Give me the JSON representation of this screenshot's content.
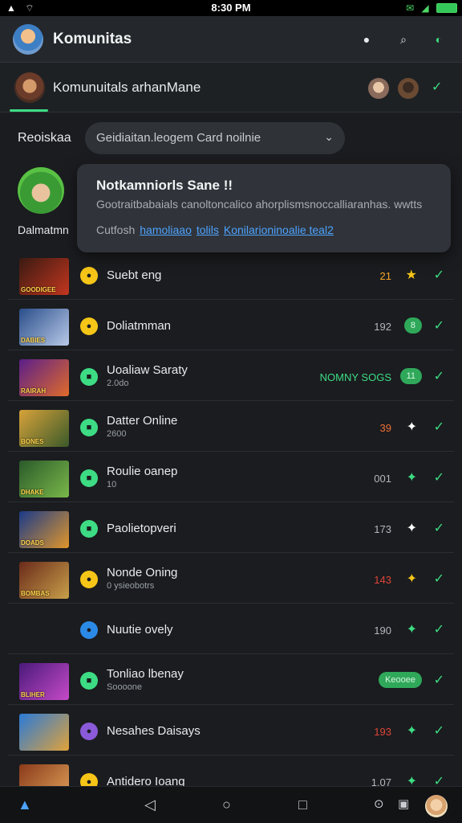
{
  "status_bar": {
    "time": "8:30 PM"
  },
  "app_bar": {
    "title": "Komunitas"
  },
  "community": {
    "name": "Komunuitals arhanMane"
  },
  "filter": {
    "label": "Reoiskaa",
    "dropdown_value": "Geidiaitan.leogem Card noilnie"
  },
  "profile": {
    "name": "Dalmatmn"
  },
  "popup": {
    "title": "Notkamniorls Sane !!",
    "body": "Gootraitbabaials canoltoncalico ahorplismsnoccalliaranhas. wwtts",
    "prefix": "Cutfosh",
    "links": [
      "hamoliaao",
      "tolils",
      "Konilarioninoalie teal2"
    ]
  },
  "list": [
    {
      "title": "Suebt eng",
      "subtitle": "",
      "count": "21",
      "count_color": "#f5a623",
      "badge_color": "#f5c518",
      "badge_icon": "●",
      "star": "★",
      "star_color": "#f5c518",
      "pill": "",
      "thumb_colors": [
        "#3a1a12",
        "#c2361f"
      ],
      "thumb_caption": "GOODIGEE"
    },
    {
      "title": "Doliatmman",
      "subtitle": "",
      "count": "192",
      "count_color": "#b3b7bc",
      "badge_color": "#f5c518",
      "badge_icon": "●",
      "star": "",
      "star_color": "",
      "pill": "8",
      "thumb_colors": [
        "#2a4e8a",
        "#b8c9e8"
      ],
      "thumb_caption": "DABIES"
    },
    {
      "title": "Uoaliaw Saraty",
      "subtitle": "2.0do",
      "count": "NOMNY SOGS",
      "count_color": "#3ddc84",
      "badge_color": "#3ddc84",
      "badge_icon": "■",
      "star": "",
      "star_color": "",
      "pill": "11",
      "thumb_colors": [
        "#5a1e8a",
        "#e06b2a"
      ],
      "thumb_caption": "RAIRAH"
    },
    {
      "title": "Datter Online",
      "subtitle": "2600",
      "count": "39",
      "count_color": "#f0703a",
      "badge_color": "#3ddc84",
      "badge_icon": "■",
      "star": "✦",
      "star_color": "#ffffff",
      "pill": "",
      "thumb_colors": [
        "#d8a23a",
        "#3a5a2a"
      ],
      "thumb_caption": "BONES"
    },
    {
      "title": "Roulie oanep",
      "subtitle": "10",
      "count": "001",
      "count_color": "#b3b7bc",
      "badge_color": "#3ddc84",
      "badge_icon": "■",
      "star": "✦",
      "star_color": "#3ddc84",
      "pill": "",
      "thumb_colors": [
        "#2a5a2a",
        "#7ab84a"
      ],
      "thumb_caption": "DHAKE"
    },
    {
      "title": "Paolietopveri",
      "subtitle": "",
      "count": "173",
      "count_color": "#b3b7bc",
      "badge_color": "#3ddc84",
      "badge_icon": "■",
      "star": "✦",
      "star_color": "#ffffff",
      "pill": "",
      "thumb_colors": [
        "#1a3a8a",
        "#e0962a"
      ],
      "thumb_caption": "DOADS"
    },
    {
      "title": "Nonde Oning",
      "subtitle": "0 ysieobotrs",
      "count": "143",
      "count_color": "#e0453a",
      "badge_color": "#f5c518",
      "badge_icon": "●",
      "star": "✦",
      "star_color": "#f5c518",
      "pill": "",
      "thumb_colors": [
        "#6a2a1a",
        "#c8a04a"
      ],
      "thumb_caption": "BOMBAS"
    },
    {
      "title": "Nuutie ovely",
      "subtitle": "",
      "count": "190",
      "count_color": "#b3b7bc",
      "badge_color": "#2b8ae6",
      "badge_icon": "●",
      "star": "✦",
      "star_color": "#3ddc84",
      "pill": "",
      "thumb_colors": [],
      "thumb_caption": ""
    },
    {
      "title": "Tonliao lbenay",
      "subtitle": "Soooone",
      "count": "",
      "count_color": "#b3b7bc",
      "badge_color": "#3ddc84",
      "badge_icon": "■",
      "star": "✦",
      "star_color": "#3ddc84",
      "pill": "Keooee",
      "thumb_colors": [
        "#4a1a7a",
        "#c64ac8"
      ],
      "thumb_caption": "BLIHER"
    },
    {
      "title": "Nesahes Daisays",
      "subtitle": "",
      "count": "193",
      "count_color": "#e0453a",
      "badge_color": "#8a5ad8",
      "badge_icon": "●",
      "star": "✦",
      "star_color": "#3ddc84",
      "pill": "",
      "thumb_colors": [
        "#2a7ad8",
        "#e0a23a"
      ],
      "thumb_caption": ""
    },
    {
      "title": "Antidero Ioang",
      "subtitle": "",
      "count": "1.07",
      "count_color": "#b3b7bc",
      "badge_color": "#f5c518",
      "badge_icon": "●",
      "star": "✦",
      "star_color": "#3ddc84",
      "pill": "",
      "thumb_colors": [
        "#8a3a1a",
        "#e0a25a"
      ],
      "thumb_caption": ""
    }
  ],
  "nav": {
    "items": [
      "◁",
      "○",
      "□"
    ]
  }
}
